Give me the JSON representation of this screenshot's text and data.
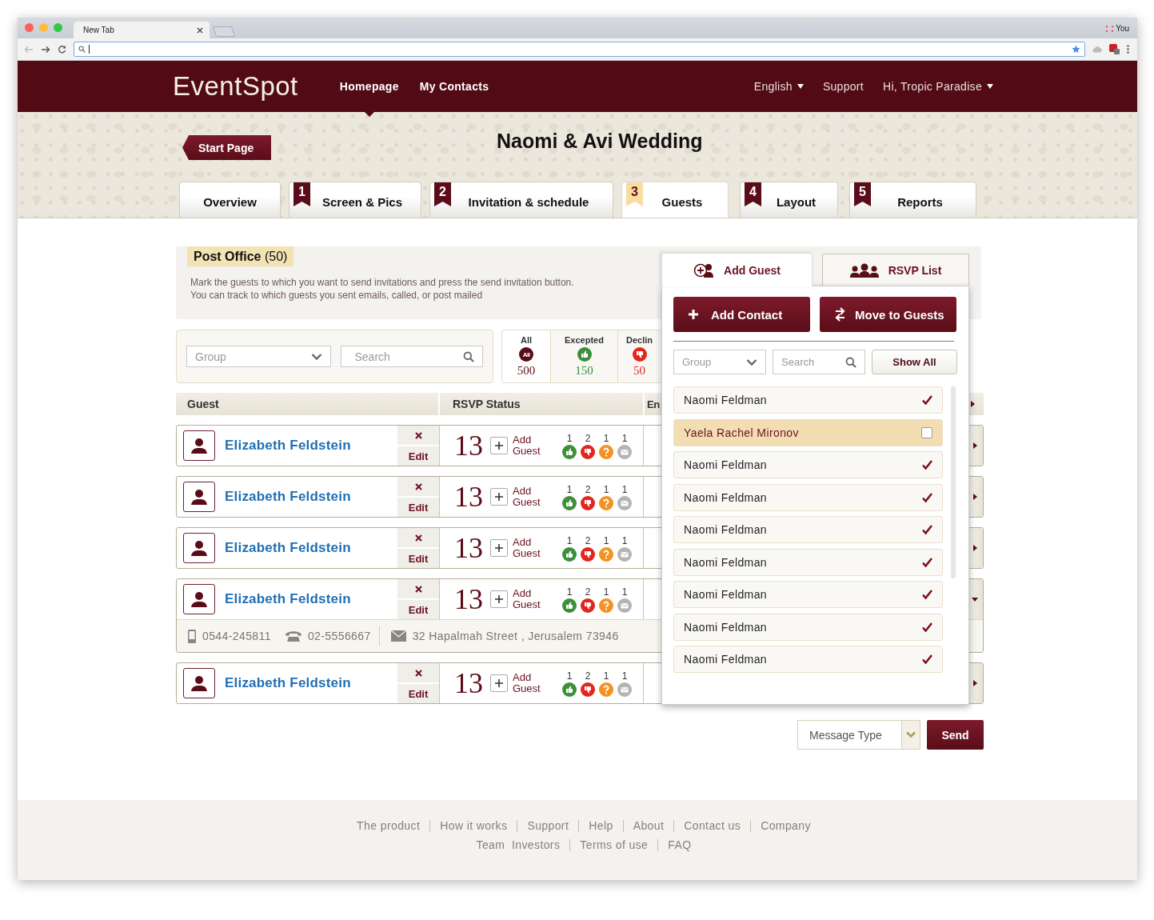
{
  "browser": {
    "tab_title": "New Tab",
    "profile": "You"
  },
  "header": {
    "logo": "EventSpot",
    "nav": [
      {
        "label": "Homepage",
        "selected": true
      },
      {
        "label": "My Contacts",
        "selected": false
      }
    ],
    "language": "English",
    "support": "Support",
    "user": "Hi, Tropic Paradise"
  },
  "start_page": "Start Page",
  "event_title": "Naomi & Avi Wedding",
  "steps": [
    {
      "label": "Overview",
      "selected": false
    },
    {
      "number": "1",
      "label": "Screen & Pics",
      "selected": false
    },
    {
      "number": "2",
      "label": "Invitation & schedule",
      "selected": false
    },
    {
      "number": "3",
      "label": "Guests",
      "selected": true
    },
    {
      "number": "4",
      "label": "Layout",
      "selected": false
    },
    {
      "number": "5",
      "label": "Reports",
      "selected": false
    }
  ],
  "post_office": {
    "title": "Post Office",
    "count": "(50)",
    "description": [
      "Mark the guests to which you want to send invitations and press the send invitation button.",
      "You can track to which guests you sent emails, called, or post mailed"
    ]
  },
  "filters": {
    "group_placeholder": "Group",
    "search_placeholder": "Search"
  },
  "stats": [
    {
      "kind": "all",
      "label": "All",
      "badge": "All",
      "value": "500",
      "selected": true
    },
    {
      "kind": "accepted",
      "label": "Excepted",
      "value": "150",
      "selected": false
    },
    {
      "kind": "declined",
      "label": "Declin",
      "value": "50",
      "selected": false
    }
  ],
  "table": {
    "columns": [
      "Guest",
      "RSVP Status",
      "En"
    ],
    "rows": [
      {
        "name": "Elizabeth Feldstein",
        "edit": "Edit",
        "guests": "13",
        "add_guest": "Add Guest",
        "rsvp": [
          {
            "kind": "accepted",
            "count": "1"
          },
          {
            "kind": "declined",
            "count": "2"
          },
          {
            "kind": "pending",
            "count": "1"
          },
          {
            "kind": "emailed",
            "count": "1"
          }
        ],
        "expanded": false
      },
      {
        "name": "Elizabeth Feldstein",
        "edit": "Edit",
        "guests": "13",
        "add_guest": "Add Guest",
        "rsvp": [
          {
            "kind": "accepted",
            "count": "1"
          },
          {
            "kind": "declined",
            "count": "2"
          },
          {
            "kind": "pending",
            "count": "1"
          },
          {
            "kind": "emailed",
            "count": "1"
          }
        ],
        "expanded": false
      },
      {
        "name": "Elizabeth Feldstein",
        "edit": "Edit",
        "guests": "13",
        "add_guest": "Add Guest",
        "rsvp": [
          {
            "kind": "accepted",
            "count": "1"
          },
          {
            "kind": "declined",
            "count": "2"
          },
          {
            "kind": "pending",
            "count": "1"
          },
          {
            "kind": "emailed",
            "count": "1"
          }
        ],
        "expanded": false
      },
      {
        "name": "Elizabeth Feldstein",
        "edit": "Edit",
        "guests": "13",
        "add_guest": "Add Guest",
        "rsvp": [
          {
            "kind": "accepted",
            "count": "1"
          },
          {
            "kind": "declined",
            "count": "2"
          },
          {
            "kind": "pending",
            "count": "1"
          },
          {
            "kind": "emailed",
            "count": "1"
          }
        ],
        "expanded": true,
        "mobile": "0544-245811",
        "phone": "02-5556667",
        "address": "32 Hapalmah Street , Jerusalem 73946"
      },
      {
        "name": "Elizabeth Feldstein",
        "edit": "Edit",
        "guests": "13",
        "add_guest": "Add Guest",
        "rsvp": [
          {
            "kind": "accepted",
            "count": "1"
          },
          {
            "kind": "declined",
            "count": "2"
          },
          {
            "kind": "pending",
            "count": "1"
          },
          {
            "kind": "emailed",
            "count": "1"
          }
        ],
        "expanded": false
      }
    ]
  },
  "add_guest_panel": {
    "tabs": [
      {
        "kind": "add",
        "label": "Add Guest",
        "selected": true
      },
      {
        "kind": "rsvp",
        "label": "RSVP List",
        "selected": false
      }
    ],
    "buttons": [
      {
        "kind": "add",
        "label": "Add Contact"
      },
      {
        "kind": "move",
        "label": "Move to Guests"
      }
    ],
    "group_placeholder": "Group",
    "search_placeholder": "Search",
    "show_all": "Show All",
    "contacts": [
      {
        "name": "Naomi Feldman",
        "checked": true,
        "selected": false
      },
      {
        "name": "Yaela Rachel Mironov",
        "checked": false,
        "selected": true
      },
      {
        "name": "Naomi Feldman",
        "checked": true,
        "selected": false
      },
      {
        "name": "Naomi Feldman",
        "checked": true,
        "selected": false
      },
      {
        "name": "Naomi Feldman",
        "checked": true,
        "selected": false
      },
      {
        "name": "Naomi Feldman",
        "checked": true,
        "selected": false
      },
      {
        "name": "Naomi Feldman",
        "checked": true,
        "selected": false
      },
      {
        "name": "Naomi Feldman",
        "checked": true,
        "selected": false
      },
      {
        "name": "Naomi Feldman",
        "checked": true,
        "selected": false
      }
    ]
  },
  "send": {
    "placeholder": "Message Type",
    "button": "Send"
  },
  "footer": [
    {
      "links": [
        "The product",
        "How it works",
        "Support",
        "Help",
        "About",
        "Contact us",
        "Company"
      ]
    },
    {
      "links": [
        "Team  Investors",
        "Terms of use",
        "FAQ"
      ]
    }
  ]
}
